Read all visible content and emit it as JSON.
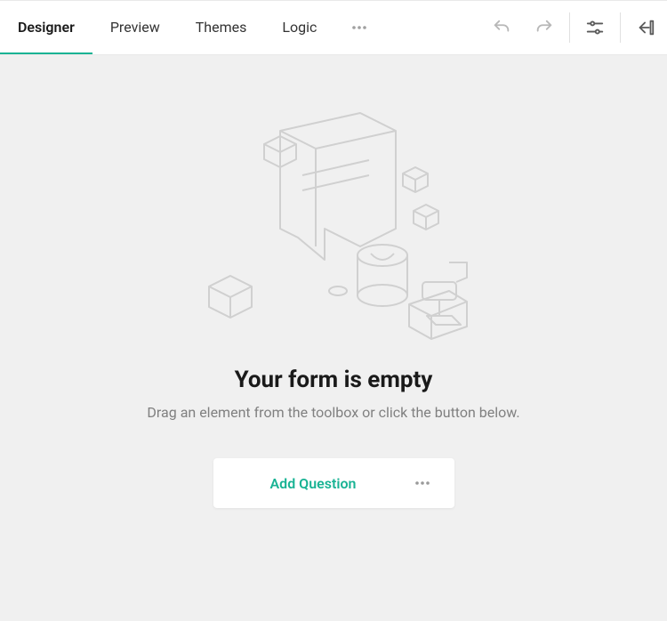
{
  "tabs": {
    "designer": "Designer",
    "preview": "Preview",
    "themes": "Themes",
    "logic": "Logic",
    "active": "designer"
  },
  "empty": {
    "title": "Your form is empty",
    "subtitle": "Drag an element from the toolbox or click the button below."
  },
  "actions": {
    "add_question": "Add Question"
  },
  "colors": {
    "accent": "#19b394"
  }
}
